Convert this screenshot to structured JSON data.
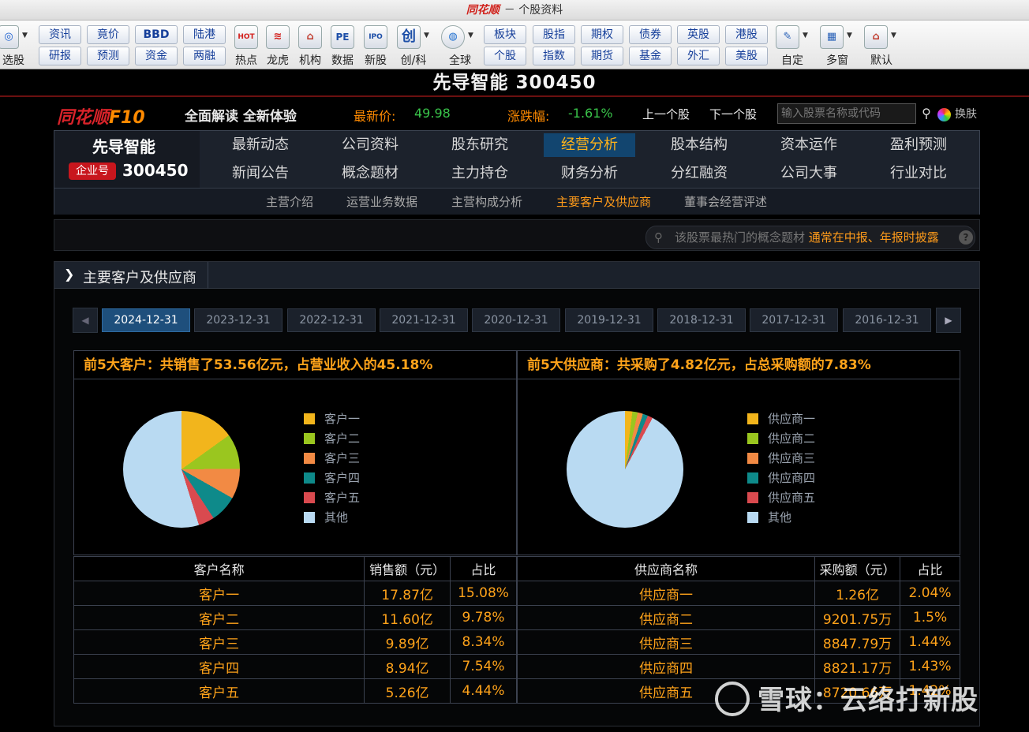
{
  "window": {
    "logo": "同花顺",
    "title": "－ 个股资料"
  },
  "toolbar": {
    "xuangu": "选股",
    "zixun": "资讯",
    "yanbao": "研报",
    "jingjia": "竟价",
    "yuce": "预测",
    "bbd": "BBD",
    "zijin": "资金",
    "lugang": "陆港",
    "liangrong": "两融",
    "redian": "热点",
    "longhu": "龙虎",
    "jigou": "机构",
    "shuju": "数据",
    "xingu": "新股",
    "chuangke": "创/科",
    "quanqiu": "全球",
    "bankuai": "板块",
    "gegu": "个股",
    "guzhi": "股指",
    "zhishu": "指数",
    "qiquan": "期权",
    "qihuo": "期货",
    "zhaiquan": "债券",
    "jijin": "基金",
    "yinggu": "英股",
    "waihui": "外汇",
    "ganggu": "港股",
    "meigu": "美股",
    "ziding": "自定",
    "duochuang": "多窗",
    "moren": "默认",
    "icon_redian_text": "HOT",
    "icon_shuju_text": "PE",
    "icon_xingu_text": "IPO",
    "icon_chuang_text": "创",
    "icon_bbd_text": "BBD"
  },
  "stock": {
    "title": "先导智能 300450"
  },
  "f10": {
    "logo_a": "同花顺",
    "logo_b": "F10",
    "slogan": "全面解读 全新体验",
    "price_label": "最新价:",
    "price_value": "49.98",
    "change_label": "涨跌幅:",
    "change_value": "-1.61%",
    "prev": "上一个股",
    "next": "下一个股",
    "search_placeholder": "输入股票名称或代码",
    "skin": "换肤"
  },
  "company": {
    "name": "先导智能",
    "tag": "企业号",
    "code": "300450"
  },
  "tabs": {
    "row1": [
      "最新动态",
      "公司资料",
      "股东研究",
      "经营分析",
      "股本结构",
      "资本运作",
      "盈利预测"
    ],
    "row2": [
      "新闻公告",
      "概念题材",
      "主力持仓",
      "财务分析",
      "分红融资",
      "公司大事",
      "行业对比"
    ],
    "active": "经营分析"
  },
  "subtabs": [
    "主营介绍",
    "运营业务数据",
    "主营构成分析",
    "主要客户及供应商",
    "董事会经营评述"
  ],
  "subtab_active": "主要客户及供应商",
  "hot": {
    "text": "该股票最热门的概念题材",
    "highlight": "通常在中报、年报时披露",
    "q": "?"
  },
  "section": {
    "title": "主要客户及供应商"
  },
  "dates": [
    "2024-12-31",
    "2023-12-31",
    "2022-12-31",
    "2021-12-31",
    "2020-12-31",
    "2019-12-31",
    "2018-12-31",
    "2017-12-31",
    "2016-12-31"
  ],
  "colors": {
    "c1": "#f2b51c",
    "c2": "#9ac61f",
    "c3": "#f28a44",
    "c4": "#0e8a8a",
    "c5": "#d94a4f",
    "c6": "#b9daf2",
    "accent": "#ffa31a"
  },
  "customers": {
    "summary": "前5大客户：共销售了53.56亿元，占营业收入的45.18%",
    "legend": [
      "客户一",
      "客户二",
      "客户三",
      "客户四",
      "客户五",
      "其他"
    ],
    "percentages": [
      15.08,
      9.78,
      8.34,
      7.54,
      4.44,
      54.82
    ],
    "headers": [
      "客户名称",
      "销售额（元）",
      "占比"
    ],
    "rows": [
      [
        "客户一",
        "17.87亿",
        "15.08%"
      ],
      [
        "客户二",
        "11.60亿",
        "9.78%"
      ],
      [
        "客户三",
        "9.89亿",
        "8.34%"
      ],
      [
        "客户四",
        "8.94亿",
        "7.54%"
      ],
      [
        "客户五",
        "5.26亿",
        "4.44%"
      ]
    ]
  },
  "suppliers": {
    "summary": "前5大供应商：共采购了4.82亿元，占总采购额的7.83%",
    "legend": [
      "供应商一",
      "供应商二",
      "供应商三",
      "供应商四",
      "供应商五",
      "其他"
    ],
    "percentages": [
      2.04,
      1.5,
      1.44,
      1.43,
      1.42,
      92.17
    ],
    "headers": [
      "供应商名称",
      "采购额（元）",
      "占比"
    ],
    "rows": [
      [
        "供应商一",
        "1.26亿",
        "2.04%"
      ],
      [
        "供应商二",
        "9201.75万",
        "1.5%"
      ],
      [
        "供应商三",
        "8847.79万",
        "1.44%"
      ],
      [
        "供应商四",
        "8821.17万",
        "1.43%"
      ],
      [
        "供应商五",
        "8720.66万",
        "1.42%"
      ]
    ]
  },
  "watermark": "雪球：云络打新股"
}
